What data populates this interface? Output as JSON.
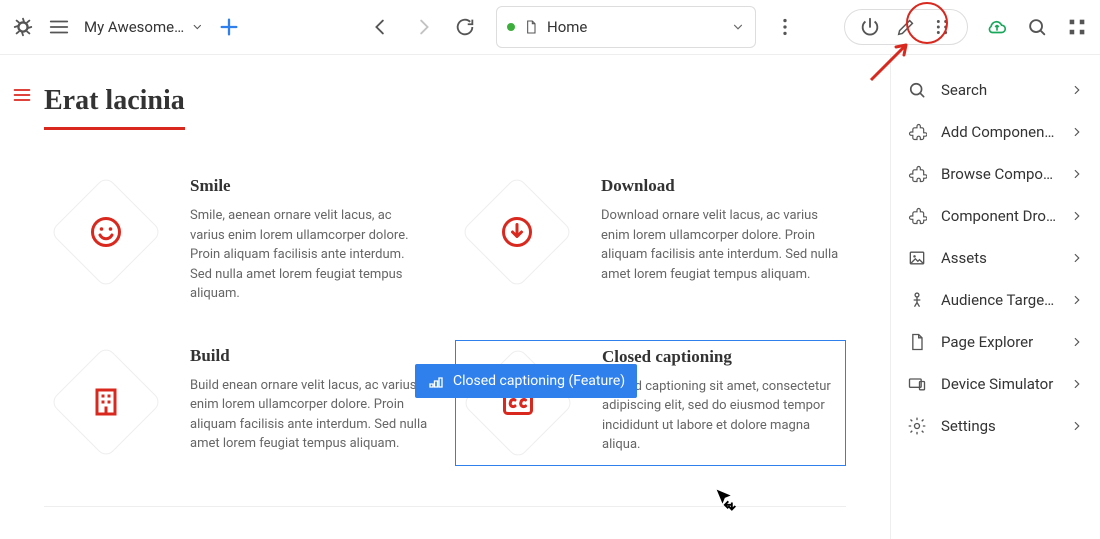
{
  "project": {
    "name": "My Awesome E…"
  },
  "address": {
    "label": "Home"
  },
  "page": {
    "title": "Erat lacinia"
  },
  "features": [
    {
      "title": "Smile",
      "body": "Smile, aenean ornare velit lacus, ac varius enim lorem ullamcorper dolore. Proin aliquam facilisis ante interdum. Sed nulla amet lorem feugiat tempus aliquam.",
      "icon": "smile-icon"
    },
    {
      "title": "Download",
      "body": "Download ornare velit lacus, ac varius enim lorem ullamcorper dolore. Proin aliquam facilisis ante interdum. Sed nulla amet lorem feugiat tempus aliquam.",
      "icon": "download-icon"
    },
    {
      "title": "Build",
      "body": "Build enean ornare velit lacus, ac varius enim lorem ullamcorper dolore. Proin aliquam facilisis ante interdum. Sed nulla amet lorem feugiat tempus aliquam.",
      "icon": "building-icon"
    },
    {
      "title": "Closed captioning",
      "body": "Closed captioning sit amet, consectetur adipiscing elit, sed do eiusmod tempor incididunt ut labore et dolore magna aliqua.",
      "icon": "cc-icon"
    }
  ],
  "selection_tag": "Closed captioning (Feature)",
  "sidepanel": [
    {
      "label": "Search",
      "icon": "search"
    },
    {
      "label": "Add Components",
      "icon": "ext"
    },
    {
      "label": "Browse Components",
      "icon": "ext"
    },
    {
      "label": "Component Drop Ta…",
      "icon": "ext"
    },
    {
      "label": "Assets",
      "icon": "image"
    },
    {
      "label": "Audience Targeting",
      "icon": "person"
    },
    {
      "label": "Page Explorer",
      "icon": "doc"
    },
    {
      "label": "Device Simulator",
      "icon": "device"
    },
    {
      "label": "Settings",
      "icon": "gear"
    }
  ]
}
